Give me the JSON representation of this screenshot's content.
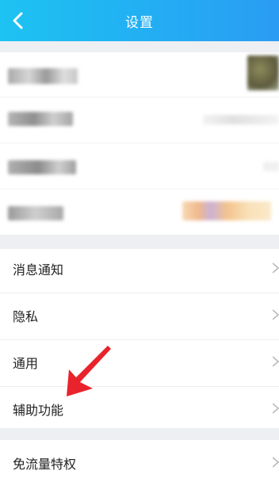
{
  "header": {
    "title": "设置",
    "background_start": "#1dc3f2",
    "background_end": "#2a9cf3"
  },
  "settings_list": {
    "items": [
      {
        "label": "消息通知"
      },
      {
        "label": "隐私"
      },
      {
        "label": "通用"
      },
      {
        "label": "辅助功能"
      }
    ]
  },
  "bottom_item": {
    "label": "免流量特权"
  },
  "annotation": {
    "color": "#e8232b",
    "icon": "red-arrow-pointer"
  },
  "chevron_color": "#b9b9b9"
}
